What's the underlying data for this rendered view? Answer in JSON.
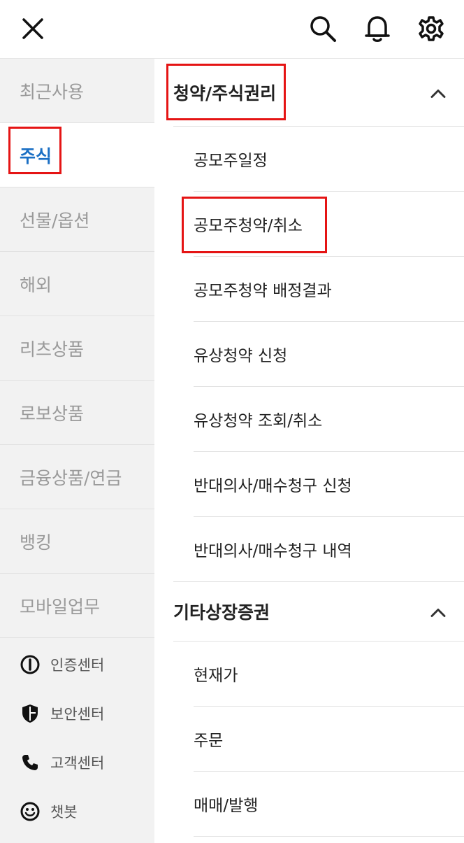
{
  "header": {
    "close_icon": "close-icon",
    "search_icon": "search-icon",
    "bell_icon": "bell-icon",
    "gear_icon": "gear-icon"
  },
  "sidebar": {
    "items": [
      {
        "label": "최근사용",
        "active": false
      },
      {
        "label": "주식",
        "active": true
      },
      {
        "label": "선물/옵션",
        "active": false
      },
      {
        "label": "해외",
        "active": false
      },
      {
        "label": "리츠상품",
        "active": false
      },
      {
        "label": "로보상품",
        "active": false
      },
      {
        "label": "금융상품/연금",
        "active": false
      },
      {
        "label": "뱅킹",
        "active": false
      },
      {
        "label": "모바일업무",
        "active": false
      }
    ],
    "utilities": [
      {
        "label": "인증센터",
        "icon": "info-circle-icon"
      },
      {
        "label": "보안센터",
        "icon": "shield-icon"
      },
      {
        "label": "고객센터",
        "icon": "phone-icon"
      },
      {
        "label": "챗봇",
        "icon": "smiley-icon"
      }
    ]
  },
  "main": {
    "sections": [
      {
        "title": "청약/주식권리",
        "expanded": true,
        "items": [
          "공모주일정",
          "공모주청약/취소",
          "공모주청약 배정결과",
          "유상청약 신청",
          "유상청약 조회/취소",
          "반대의사/매수청구 신청",
          "반대의사/매수청구 내역"
        ]
      },
      {
        "title": "기타상장증권",
        "expanded": true,
        "items": [
          "현재가",
          "주문",
          "매매/발행"
        ]
      }
    ]
  },
  "colors": {
    "accent": "#1a6fc4",
    "highlight_box": "#e51414",
    "sidebar_bg": "#f2f2f2"
  }
}
